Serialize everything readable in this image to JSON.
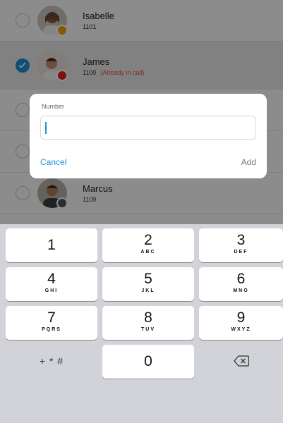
{
  "contacts": [
    {
      "name": "Isabelle",
      "ext": "1101",
      "note": "",
      "selected": false,
      "status_color": "#f0a500"
    },
    {
      "name": "James",
      "ext": "1100",
      "note": "(Already in call)",
      "selected": true,
      "status_color": "#e02020"
    },
    {
      "name": "",
      "ext": "",
      "note": "",
      "selected": false,
      "status_color": ""
    },
    {
      "name": "",
      "ext": "",
      "note": "",
      "selected": false,
      "status_color": ""
    },
    {
      "name": "Marcus",
      "ext": "1109",
      "note": "",
      "selected": false,
      "status_color": "#555555"
    }
  ],
  "dialog": {
    "label": "Number",
    "value": "",
    "cancel_label": "Cancel",
    "add_label": "Add"
  },
  "keypad": {
    "keys": [
      {
        "digit": "1",
        "letters": ""
      },
      {
        "digit": "2",
        "letters": "ABC"
      },
      {
        "digit": "3",
        "letters": "DEF"
      },
      {
        "digit": "4",
        "letters": "GHI"
      },
      {
        "digit": "5",
        "letters": "JKL"
      },
      {
        "digit": "6",
        "letters": "MNO"
      },
      {
        "digit": "7",
        "letters": "PQRS"
      },
      {
        "digit": "8",
        "letters": "TUV"
      },
      {
        "digit": "9",
        "letters": "WXYZ"
      },
      {
        "digit": "0",
        "letters": ""
      }
    ],
    "symbols_label": "+ * #",
    "backspace_icon": "backspace-icon"
  },
  "colors": {
    "accent": "#1a8fdc",
    "note_red": "#e04a4a"
  }
}
